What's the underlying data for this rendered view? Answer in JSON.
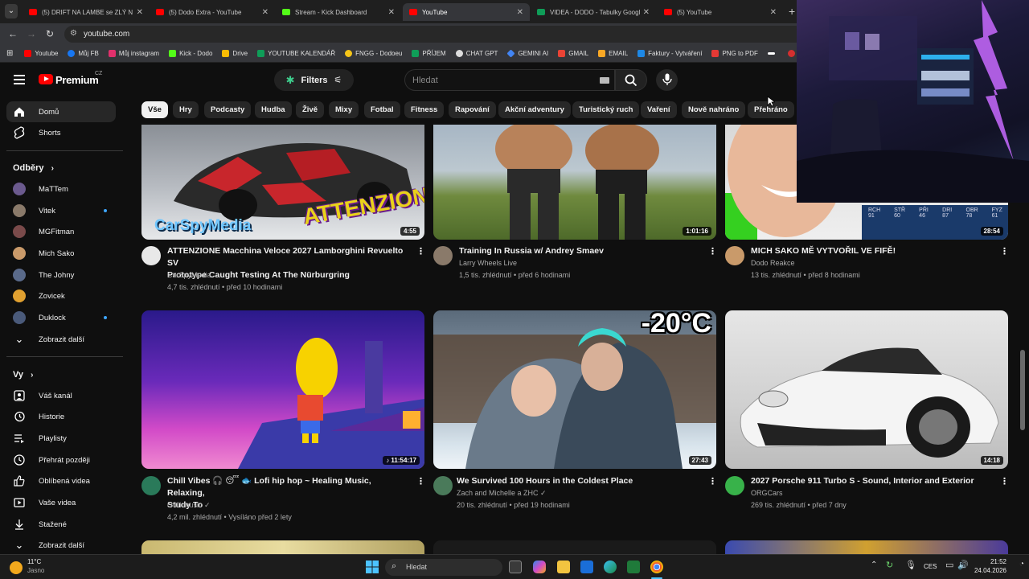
{
  "browser": {
    "tabs": [
      {
        "title": "(5) DRIFT NA LAMBE se ZLÝ N...",
        "favicon_color": "#ff0000"
      },
      {
        "title": "(5) Dodo Extra - YouTube",
        "favicon_color": "#ff0000"
      },
      {
        "title": "Stream - Kick Dashboard",
        "favicon_color": "#53fc18"
      },
      {
        "title": "YouTube",
        "favicon_color": "#ff0000"
      },
      {
        "title": "VIDEA - DODO - Tabulky Googl...",
        "favicon_color": "#0f9d58"
      },
      {
        "title": "(5) YouTube",
        "favicon_color": "#ff0000"
      }
    ],
    "url": "youtube.com",
    "bookmarks": [
      {
        "label": "Youtube",
        "icon_color": "#ff0000"
      },
      {
        "label": "Můj FB",
        "icon_color": "#1877f2"
      },
      {
        "label": "Můj instagram",
        "icon_color": "#e1306c"
      },
      {
        "label": "Kick - Dodo",
        "icon_color": "#53fc18"
      },
      {
        "label": "Drive",
        "icon_color": "#fbbc04"
      },
      {
        "label": "YOUTUBE KALENDÁŘ",
        "icon_color": "#0f9d58"
      },
      {
        "label": "FNGG - Dodoeu",
        "icon_color": "#f5c518"
      },
      {
        "label": "PŘÍJEM",
        "icon_color": "#0f9d58"
      },
      {
        "label": "CHAT GPT",
        "icon_color": "#dddddd"
      },
      {
        "label": "GEMINI AI",
        "icon_color": "#4285f4"
      },
      {
        "label": "GMAIL",
        "icon_color": "#ea4335"
      },
      {
        "label": "EMAIL",
        "icon_color": "#f9a825"
      },
      {
        "label": "Faktury - Vytváření",
        "icon_color": "#1e88e5"
      },
      {
        "label": "PNG to PDF",
        "icon_color": "#e53935"
      },
      {
        "label": "",
        "icon_color": "#ffffff"
      },
      {
        "label": "htt",
        "icon_color": "#d32f2f"
      }
    ]
  },
  "header": {
    "logo_text": "Premium",
    "region": "CZ",
    "filters_label": "Filters",
    "search_placeholder": "Hledat"
  },
  "chips": [
    "Vše",
    "Hry",
    "Podcasty",
    "Hudba",
    "Živě",
    "Mixy",
    "Fotbal",
    "Fitness",
    "Rapování",
    "Akční adventury",
    "Turistický ruch",
    "Vaření",
    "Nově nahráno",
    "Přehráno"
  ],
  "sidebar": {
    "main": [
      {
        "label": "Domů",
        "icon": "home-icon"
      },
      {
        "label": "Shorts",
        "icon": "shorts-icon"
      }
    ],
    "subscriptions_title": "Odběry",
    "subscriptions": [
      {
        "label": "MaTTem",
        "avatar_color": "#6b5a8e",
        "new": false
      },
      {
        "label": "Vitek",
        "avatar_color": "#8a7a6a",
        "new": true
      },
      {
        "label": "MGFitman",
        "avatar_color": "#7a4a4a",
        "new": false
      },
      {
        "label": "Mich Sako",
        "avatar_color": "#c99a6a",
        "new": false
      },
      {
        "label": "The Johny",
        "avatar_color": "#5a6a8a",
        "new": false
      },
      {
        "label": "Zovicek",
        "avatar_color": "#e0a030",
        "new": false
      },
      {
        "label": "Duklock",
        "avatar_color": "#4a5a7a",
        "new": true
      }
    ],
    "show_more": "Zobrazit další",
    "you_title": "Vy",
    "you_items": [
      {
        "label": "Váš kanál",
        "icon": "channel-icon"
      },
      {
        "label": "Historie",
        "icon": "history-icon"
      },
      {
        "label": "Playlisty",
        "icon": "playlists-icon"
      },
      {
        "label": "Přehrát později",
        "icon": "watch-later-icon"
      },
      {
        "label": "Oblíbená videa",
        "icon": "liked-icon"
      },
      {
        "label": "Vaše videa",
        "icon": "your-videos-icon"
      },
      {
        "label": "Stažené",
        "icon": "downloads-icon"
      },
      {
        "label": "Zobrazit další",
        "icon": "chevron-down-icon"
      }
    ]
  },
  "videos": [
    {
      "title_l1": "ATTENZIONE Macchina Veloce 2027 Lamborghini Revuelto SV",
      "title_l2": "Prototype Caught Testing At The Nürburgring",
      "channel": "CarSpyMedia",
      "meta": "4,7 tis. zhlédnutí • před 10 hodinami",
      "duration": "4:55",
      "thumb_text": "ATTENZIONE",
      "thumb_text2": "CarSpyMedia"
    },
    {
      "title_l1": "Training In Russia w/ Andrey Smaev",
      "title_l2": "",
      "channel": "Larry Wheels Live",
      "meta": "1,5 tis. zhlédnutí • před 6 hodinami",
      "duration": "1:01:16"
    },
    {
      "title_l1": "MICH SAKO MĚ VYTVOŘIL VE FIFĚ!",
      "title_l2": "",
      "channel": "Dodo Reakce",
      "meta": "13 tis. zhlédnutí • před 8 hodinami",
      "duration": "28:54",
      "stats": [
        "RCH 91",
        "STŘ 60",
        "PŘI 46",
        "DRI 87",
        "OBR 78",
        "FYZ 61"
      ]
    },
    {
      "title_l1": "Chill Vibes 🎧 😴 🐟 Lofi hip hop ~ Healing Music, Relaxing,",
      "title_l2": "Study To",
      "channel": "chilli music ✓",
      "meta": "4,2 mil. zhlédnutí • Vysíláno před 2 lety",
      "duration": "♪ 11:54:17"
    },
    {
      "title_l1": "We Survived 100 Hours in the Coldest Place",
      "title_l2": "",
      "channel": "Zach and Michelle a ZHC ✓",
      "meta": "20 tis. zhlédnutí • před 19 hodinami",
      "duration": "27:43",
      "thumb_text": "-20°C"
    },
    {
      "title_l1": "2027 Porsche 911 Turbo S - Sound, Interior and Exterior",
      "title_l2": "",
      "channel": "ORGCars",
      "meta": "269 tis. zhlédnutí • před 7 dny",
      "duration": "14:18"
    }
  ],
  "taskbar": {
    "weather_temp": "11°C",
    "weather_desc": "Jasno",
    "search_placeholder": "Hledat",
    "lang": "CES",
    "time": "21:52",
    "date": "24.04.2026"
  }
}
